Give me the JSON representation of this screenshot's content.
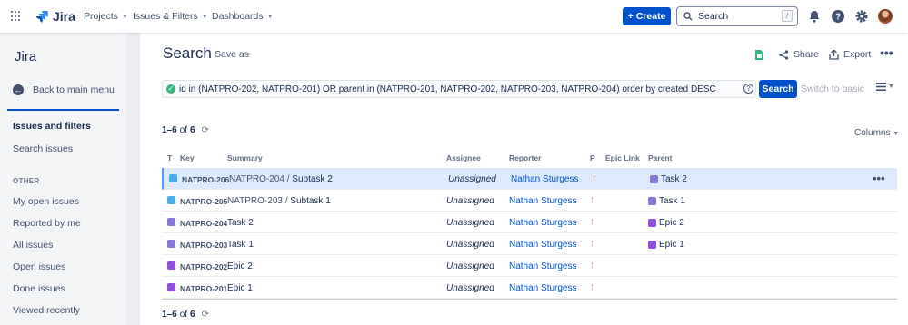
{
  "header": {
    "app_name": "Jira",
    "nav": [
      {
        "label": "Projects"
      },
      {
        "label": "Issues & Filters"
      },
      {
        "label": "Dashboards"
      }
    ],
    "create_label": "Create",
    "search_placeholder": "Search",
    "search_shortcut": "/",
    "icons": [
      "app-switcher-icon",
      "notifications-icon",
      "help-icon",
      "settings-icon",
      "avatar"
    ]
  },
  "sidebar": {
    "title": "Jira",
    "back_label": "Back to main menu",
    "section_heading": "Issues and filters",
    "search_issues": "Search issues",
    "other_heading": "OTHER",
    "items": [
      "My open issues",
      "Reported by me",
      "All issues",
      "Open issues",
      "Done issues",
      "Viewed recently"
    ]
  },
  "main": {
    "title": "Search",
    "save_as": "Save as",
    "actions": {
      "share": "Share",
      "export": "Export"
    },
    "jql": "id in (NATPRO-202, NATPRO-201) OR parent in (NATPRO-201, NATPRO-202, NATPRO-203, NATPRO-204)  order by created DESC",
    "search_button": "Search",
    "switch_basic": "Switch to basic",
    "count_range": "1–6",
    "count_of": "of",
    "count_total": "6",
    "columns_label": "Columns",
    "table_headers": {
      "t": "T",
      "key": "Key",
      "summary": "Summary",
      "assignee": "Assignee",
      "reporter": "Reporter",
      "p": "P",
      "epic_link": "Epic Link",
      "parent": "Parent"
    },
    "rows": [
      {
        "type": "subtask",
        "key": "NATPRO-206",
        "parent_summary": "NATPRO-204",
        "sep": "/",
        "summary": "Subtask 2",
        "assignee": "Unassigned",
        "reporter": "Nathan Sturgess",
        "priority": "↑",
        "parent_type": "task",
        "parent": "Task 2",
        "selected": true
      },
      {
        "type": "subtask",
        "key": "NATPRO-205",
        "parent_summary": "NATPRO-203",
        "sep": "/",
        "summary": "Subtask 1",
        "assignee": "Unassigned",
        "reporter": "Nathan Sturgess",
        "priority": "↑",
        "parent_type": "task",
        "parent": "Task 1"
      },
      {
        "type": "task",
        "key": "NATPRO-204",
        "parent_summary": "",
        "sep": "",
        "summary": "Task 2",
        "assignee": "Unassigned",
        "reporter": "Nathan Sturgess",
        "priority": "↑",
        "parent_type": "epic",
        "parent": "Epic 2"
      },
      {
        "type": "task",
        "key": "NATPRO-203",
        "parent_summary": "",
        "sep": "",
        "summary": "Task 1",
        "assignee": "Unassigned",
        "reporter": "Nathan Sturgess",
        "priority": "↑",
        "parent_type": "epic",
        "parent": "Epic 1"
      },
      {
        "type": "epic",
        "key": "NATPRO-202",
        "parent_summary": "",
        "sep": "",
        "summary": "Epic 2",
        "assignee": "Unassigned",
        "reporter": "Nathan Sturgess",
        "priority": "↑",
        "parent_type": "",
        "parent": ""
      },
      {
        "type": "epic",
        "key": "NATPRO-201",
        "parent_summary": "",
        "sep": "",
        "summary": "Epic 1",
        "assignee": "Unassigned",
        "reporter": "Nathan Sturgess",
        "priority": "↑",
        "parent_type": "",
        "parent": ""
      }
    ]
  },
  "colors": {
    "primary": "#0052cc",
    "priority": "#ff7452",
    "success": "#36b37e",
    "subtask": "#4bade8",
    "task": "#8777d9",
    "epic": "#904ee2"
  }
}
